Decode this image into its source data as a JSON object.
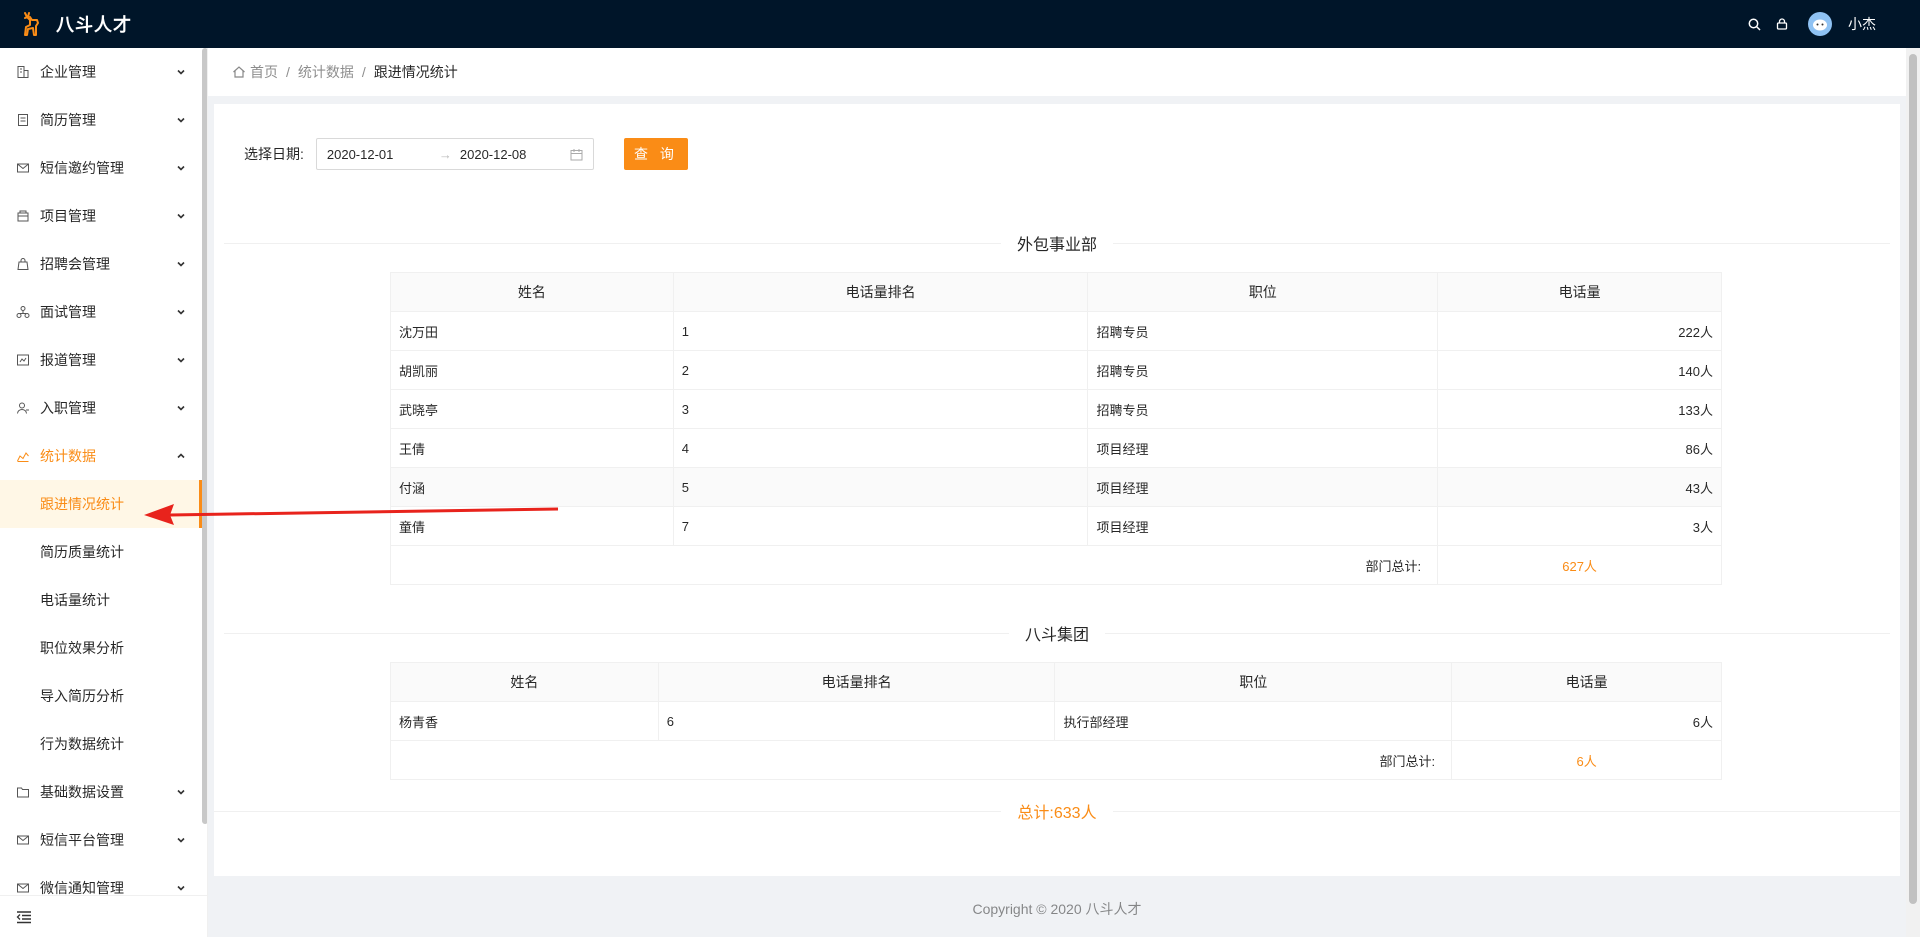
{
  "app": {
    "title": "八斗人才"
  },
  "header": {
    "user_name": "小杰"
  },
  "sidebar": {
    "items": [
      {
        "label": "企业管理",
        "icon": "building-icon"
      },
      {
        "label": "简历管理",
        "icon": "file-icon"
      },
      {
        "label": "短信邀约管理",
        "icon": "mail-icon"
      },
      {
        "label": "项目管理",
        "icon": "project-icon"
      },
      {
        "label": "招聘会管理",
        "icon": "bag-icon"
      },
      {
        "label": "面试管理",
        "icon": "cluster-icon"
      },
      {
        "label": "报道管理",
        "icon": "report-icon"
      },
      {
        "label": "入职管理",
        "icon": "user-icon"
      },
      {
        "label": "统计数据",
        "icon": "chart-icon"
      }
    ],
    "stats_children": [
      "跟进情况统计",
      "简历质量统计",
      "电话量统计",
      "职位效果分析",
      "导入简历分析",
      "行为数据统计"
    ],
    "items_after": [
      {
        "label": "基础数据设置",
        "icon": "folder-icon"
      },
      {
        "label": "短信平台管理",
        "icon": "mail-icon"
      },
      {
        "label": "微信通知管理",
        "icon": "mail-icon"
      }
    ]
  },
  "breadcrumb": {
    "home": "首页",
    "section": "统计数据",
    "current": "跟进情况统计"
  },
  "filter": {
    "label": "选择日期:",
    "start_date": "2020-12-01",
    "end_date": "2020-12-08",
    "query_button": "查 询"
  },
  "departments": [
    {
      "name": "外包事业部",
      "columns": [
        "姓名",
        "电话量排名",
        "职位",
        "电话量"
      ],
      "rows": [
        [
          "沈万田",
          "1",
          "招聘专员",
          "222人"
        ],
        [
          "胡凯丽",
          "2",
          "招聘专员",
          "140人"
        ],
        [
          "武晓亭",
          "3",
          "招聘专员",
          "133人"
        ],
        [
          "王倩",
          "4",
          "项目经理",
          "86人"
        ],
        [
          "付涵",
          "5",
          "项目经理",
          "43人"
        ],
        [
          "童倩",
          "7",
          "项目经理",
          "3人"
        ]
      ],
      "total_label": "部门总计:",
      "total_value": "627人"
    },
    {
      "name": "八斗集团",
      "columns": [
        "姓名",
        "电话量排名",
        "职位",
        "电话量"
      ],
      "rows": [
        [
          "杨青香",
          "6",
          "执行部经理",
          "6人"
        ]
      ],
      "total_label": "部门总计:",
      "total_value": "6人"
    }
  ],
  "grand_total": "总计:633人",
  "footer": "Copyright © 2020 八斗人才",
  "colors": {
    "accent": "#fa8c16",
    "header_bg": "#001529",
    "annotation_arrow": "#e8231c"
  }
}
